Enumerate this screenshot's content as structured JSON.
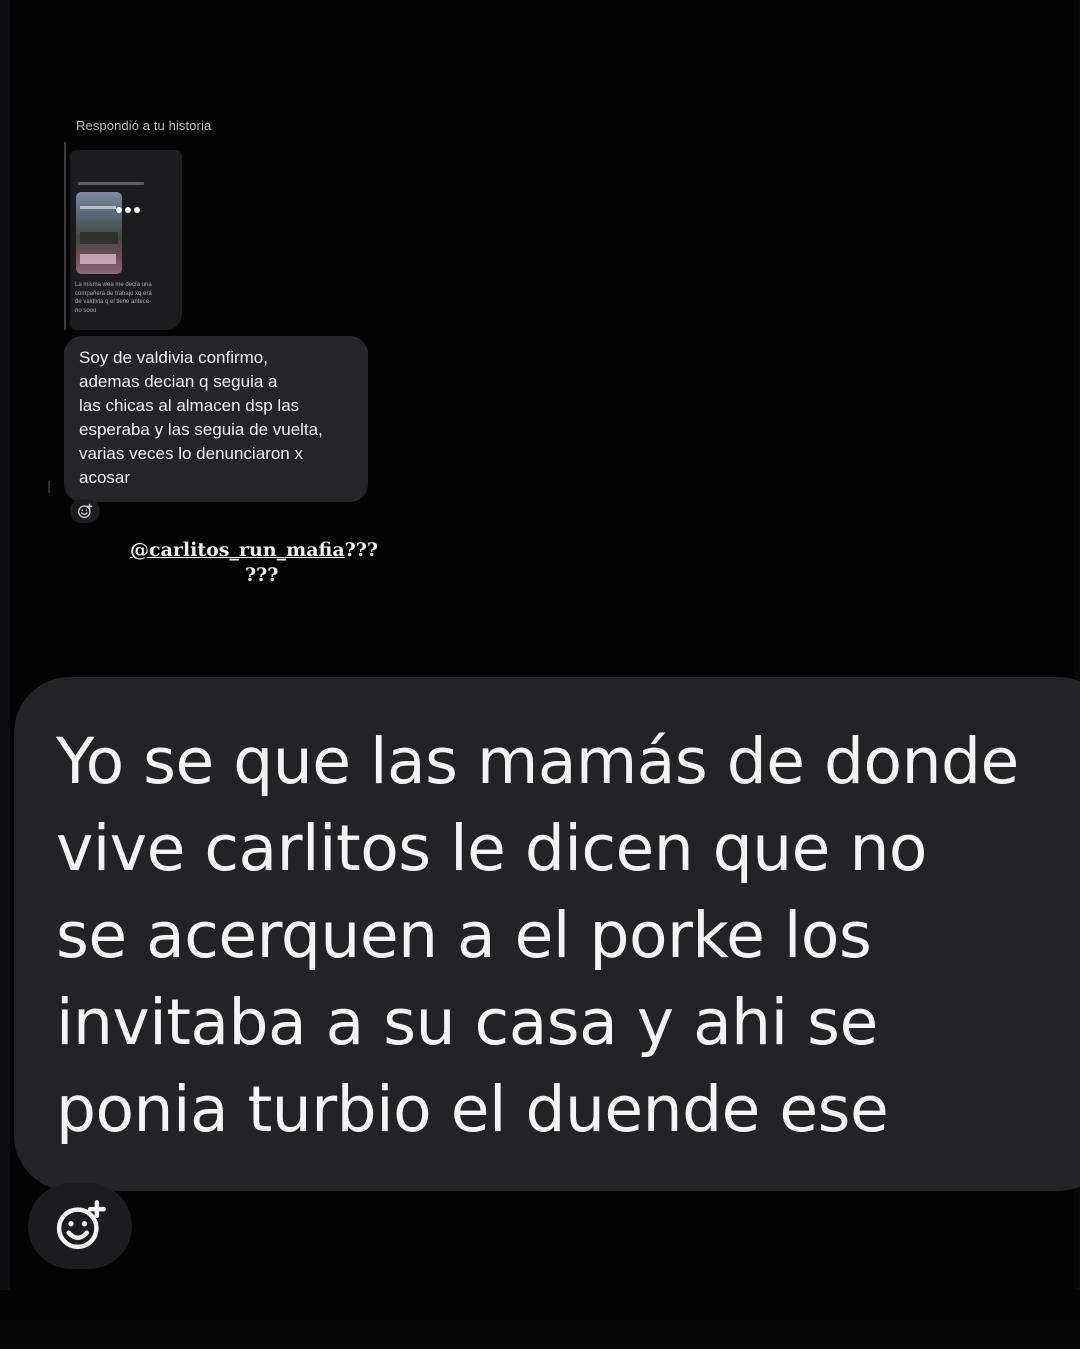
{
  "story_reply": {
    "label": "Respondió a tu historia",
    "caption": "La misma wea me decía una\ncompañera de trabajo xq era\nde valdivia q el tiene antece-\nno sooo"
  },
  "small_message": {
    "text": "Soy de valdivia confirmo,\nademas decian q seguia a\nlas chicas al almacen dsp las\nesperaba y las seguia de vuelta,\nvarias veces lo denunciaron x\nacosar"
  },
  "mention": {
    "handle": "@carlitos_run_mafia",
    "suffix": "???",
    "line2": "???"
  },
  "big_message": {
    "text": "Yo se que las mamás de donde\nvive carlitos le dicen que no\nse acerquen a el porke los\ninvitaba a su casa y ahi se\nponia turbio el duende ese"
  },
  "icons": {
    "reaction": "add-reaction-icon",
    "more": "more-dots-icon"
  },
  "colors": {
    "background": "#020202",
    "bubble": "#232326",
    "text": "#f4f4f4"
  }
}
